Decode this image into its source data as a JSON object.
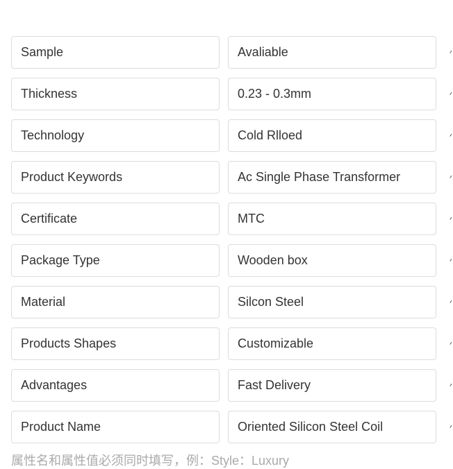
{
  "attributes": [
    {
      "name": "Sample",
      "value": "Avaliable"
    },
    {
      "name": "Thickness",
      "value": "0.23 - 0.3mm"
    },
    {
      "name": "Technology",
      "value": "Cold Rlloed"
    },
    {
      "name": "Product Keywords",
      "value": "Ac Single Phase Transformer"
    },
    {
      "name": "Certificate",
      "value": "MTC"
    },
    {
      "name": "Package Type",
      "value": "Wooden box"
    },
    {
      "name": "Material",
      "value": "Silcon Steel"
    },
    {
      "name": "Products Shapes",
      "value": "Customizable"
    },
    {
      "name": "Advantages",
      "value": "Fast Delivery"
    },
    {
      "name": "Product Name",
      "value": "Oriented Silicon Steel Coil"
    }
  ],
  "hint": "属性名和属性值必须同时填写，例：Style：Luxury"
}
